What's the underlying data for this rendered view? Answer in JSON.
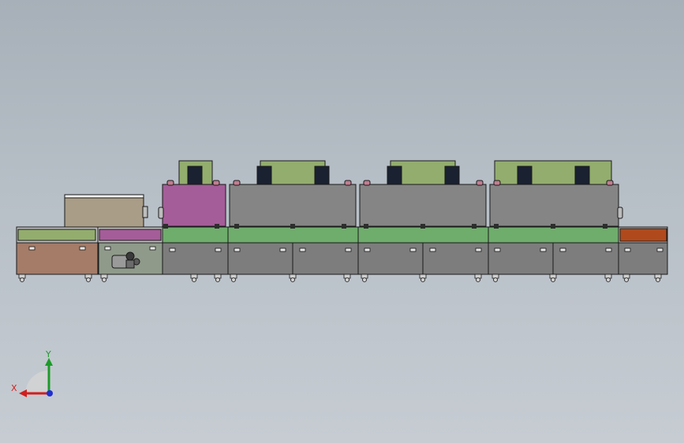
{
  "viewport": {
    "background": "#b3bbc3"
  },
  "model": {
    "name": "conveyor-oven-machine",
    "colors": {
      "frame_gray": "#7d7d7d",
      "chamber_gray": "#858585",
      "belt_green": "#6fad6c",
      "hood_green": "#93ad6e",
      "magenta": "#a45d98",
      "tan": "#a99d87",
      "brown": "#a47c68",
      "orange": "#b04a1c",
      "fan_dark": "#1a2130",
      "outline": "#1a1a1a"
    }
  },
  "triad": {
    "x_label": "X",
    "y_label": "Y",
    "x_color": "#d11f1f",
    "y_color": "#1d9a2a",
    "z_color": "#1f2fd1"
  }
}
